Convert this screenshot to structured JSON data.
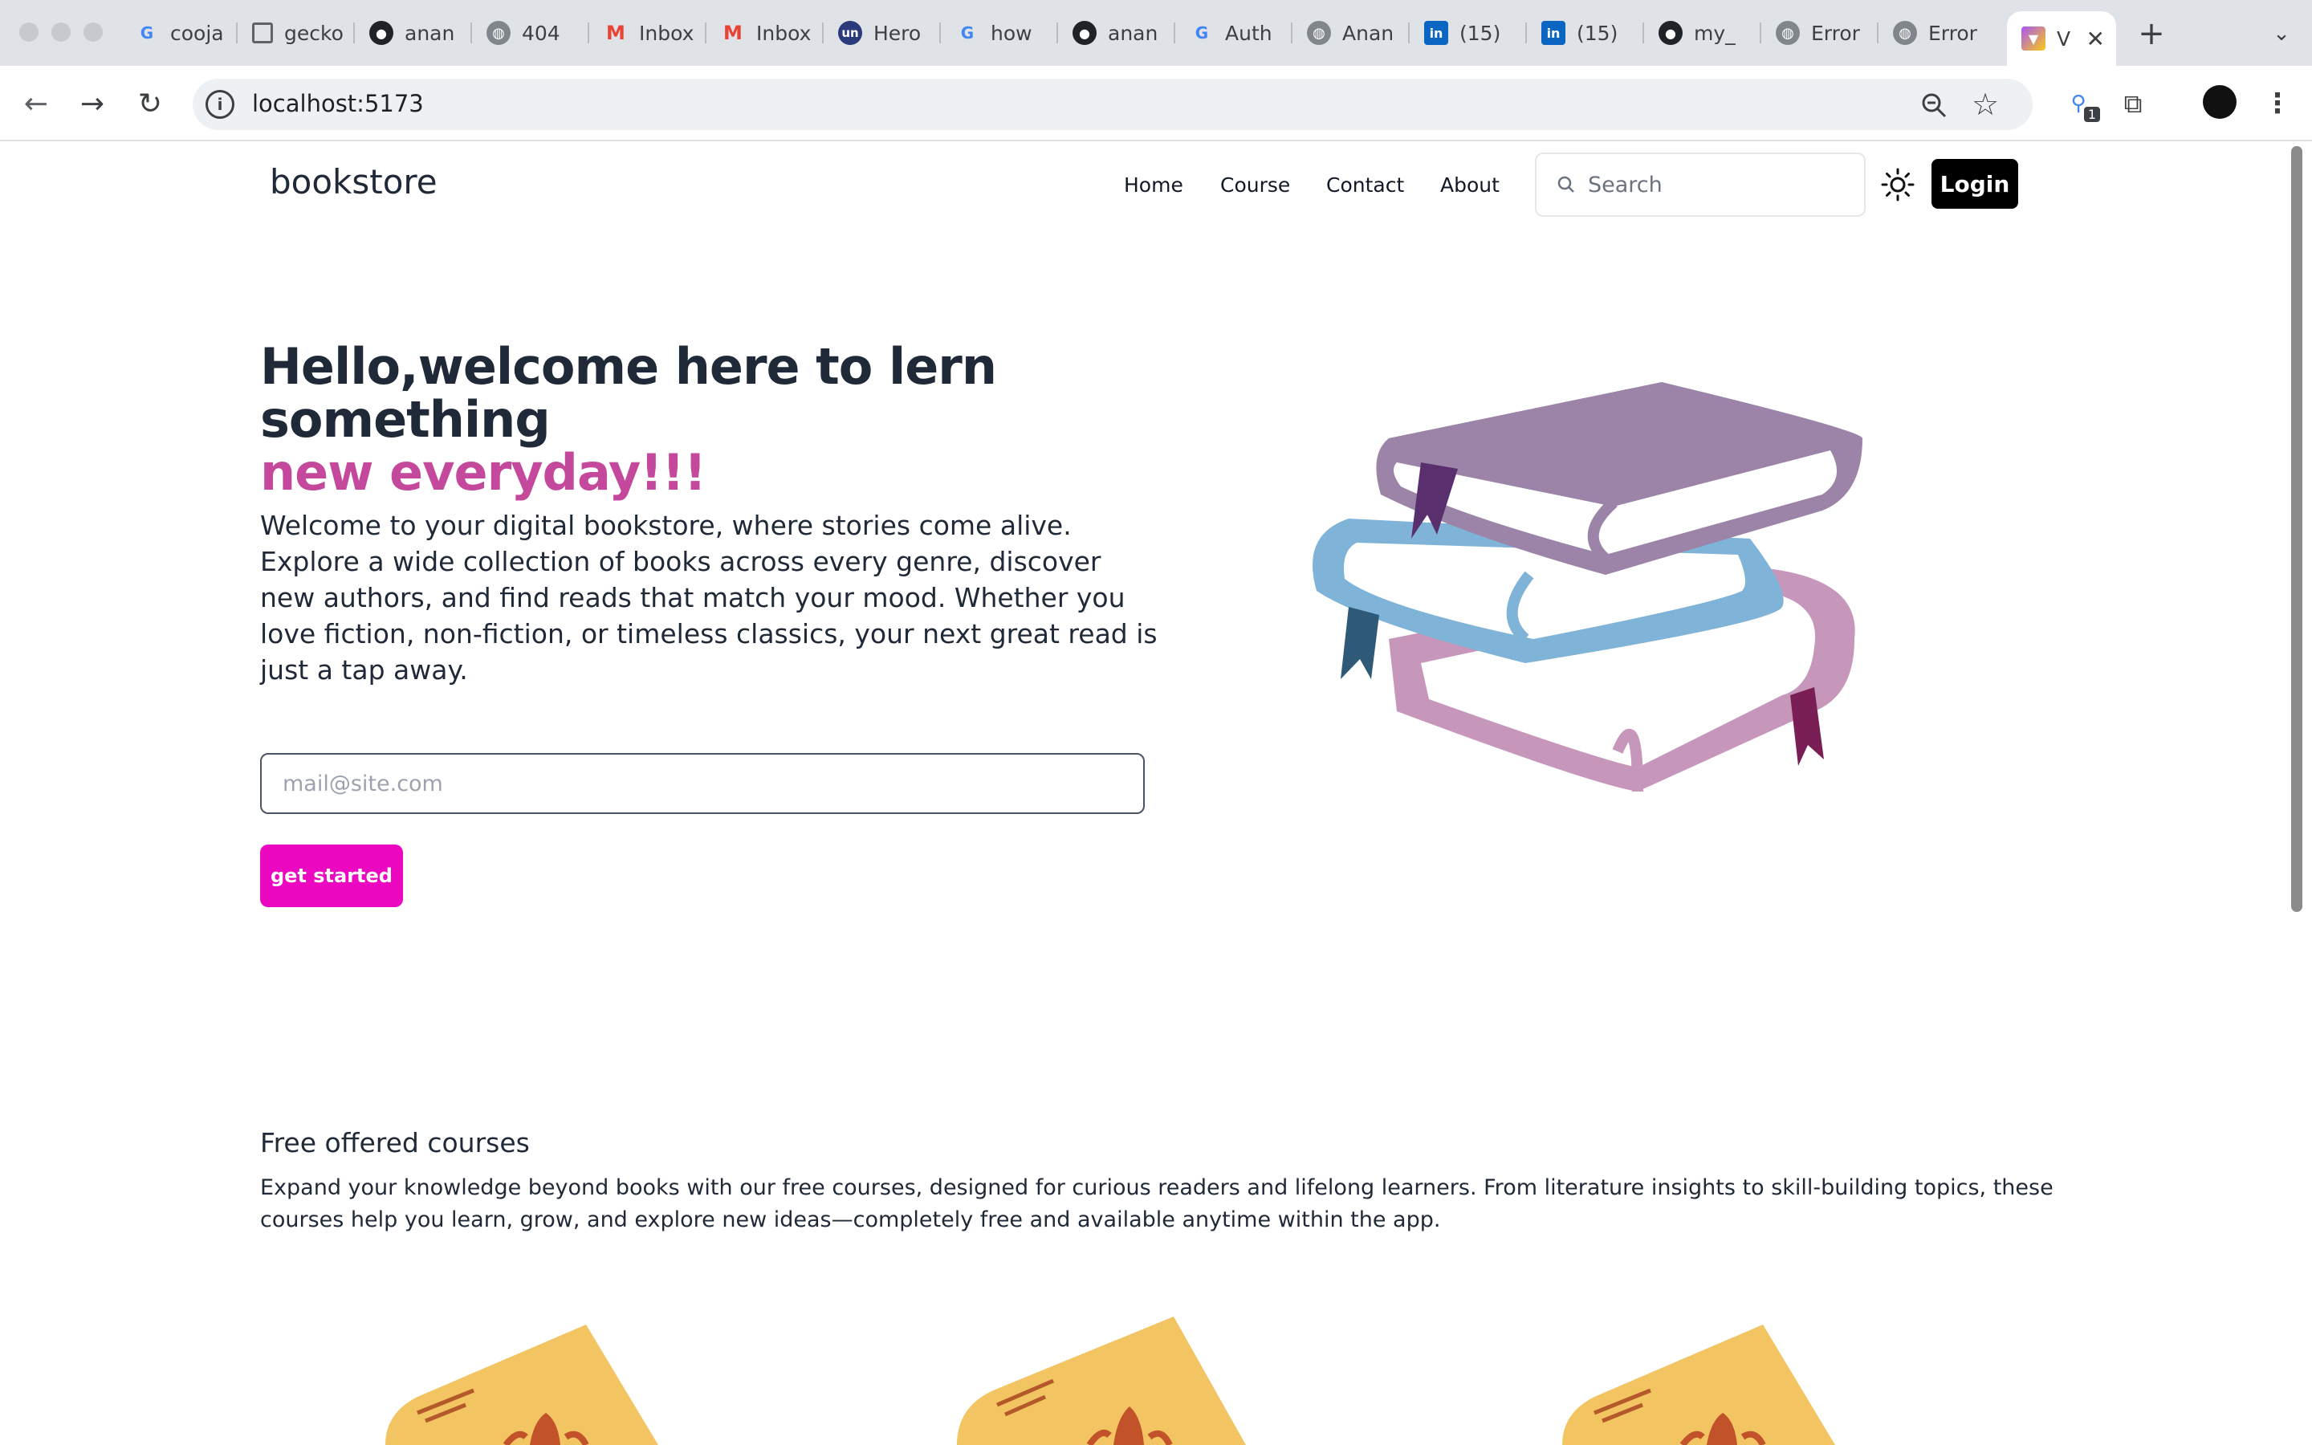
{
  "browser": {
    "tabs": [
      {
        "label": "cooja",
        "icon": "google-icon"
      },
      {
        "label": "gecko",
        "icon": "doc-icon"
      },
      {
        "label": "anan",
        "icon": "github-icon"
      },
      {
        "label": "404",
        "icon": "globe-icon"
      },
      {
        "label": "Inbox",
        "icon": "gmail-icon"
      },
      {
        "label": "Inbox",
        "icon": "gmail-icon"
      },
      {
        "label": "Hero",
        "icon": "un-icon"
      },
      {
        "label": "how",
        "icon": "google-icon"
      },
      {
        "label": "anan",
        "icon": "github-icon"
      },
      {
        "label": "Auth",
        "icon": "google-icon"
      },
      {
        "label": "Anan",
        "icon": "globe-icon"
      },
      {
        "label": "(15)",
        "icon": "linkedin-icon"
      },
      {
        "label": "(15)",
        "icon": "linkedin-icon"
      },
      {
        "label": "my_",
        "icon": "github-icon"
      },
      {
        "label": "Error",
        "icon": "globe-icon"
      },
      {
        "label": "Error",
        "icon": "globe-icon"
      },
      {
        "label": "V",
        "icon": "vite-icon"
      }
    ],
    "url": "localhost:5173",
    "extension_badge": "1"
  },
  "navbar": {
    "brand": "bookstore",
    "links": [
      "Home",
      "Course",
      "Contact",
      "About"
    ],
    "search_placeholder": "Search",
    "login_label": "Login"
  },
  "hero": {
    "title_line1": "Hello,welcome here to lern something",
    "title_line2": "new everyday!!!",
    "description": "Welcome to your digital bookstore, where stories come alive. Explore a wide collection of books across every genre, discover new authors, and find reads that match your mood. Whether you love fiction, non-fiction, or timeless classics, your next great read is just a tap away.",
    "email_placeholder": "mail@site.com",
    "cta_label": "get started"
  },
  "courses": {
    "title": "Free offered courses",
    "description": "Expand your knowledge beyond books with our free courses, designed for curious readers and lifelong learners. From literature insights to skill-building topics, these courses help you learn, grow, and explore new ideas—completely free and available anytime within the app."
  },
  "colors": {
    "accent_pink": "#c4489b",
    "button_magenta": "#ec07c0",
    "login_black": "#000000",
    "book_purple": "#9b84a8",
    "book_blue": "#7fb3d8",
    "book_pink": "#c697bb",
    "card_yellow": "#f2c462"
  }
}
